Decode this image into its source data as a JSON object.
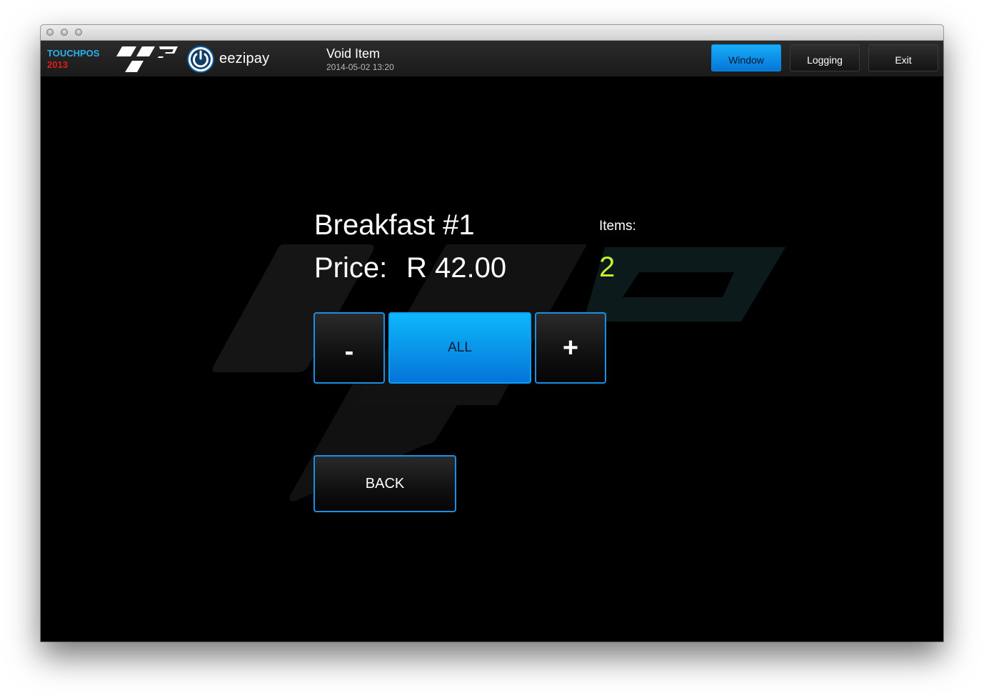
{
  "window": {
    "traffic_lights": [
      "close",
      "minimize",
      "zoom"
    ]
  },
  "header": {
    "brand_line1": "TOUCHPOS",
    "brand_line2": "2013",
    "brand_name": "eezipay",
    "screen_title": "Void Item",
    "screen_timestamp": "2014-05-02 13:20",
    "buttons": [
      {
        "label": "Window",
        "active": true
      },
      {
        "label": "Logging",
        "active": false
      },
      {
        "label": "Exit",
        "active": false
      }
    ]
  },
  "item": {
    "name": "Breakfast #1",
    "price_label": "Price:",
    "price_value": "R 42.00",
    "items_label": "Items:",
    "items_count": "2"
  },
  "controls": {
    "decrease_label": "-",
    "all_label": "ALL",
    "increase_label": "+",
    "back_label": "BACK"
  },
  "colors": {
    "accent": "#0a9ff0",
    "brand_blue": "#27b1ee",
    "brand_red": "#e01c1c",
    "count_green": "#c4f032"
  },
  "icons": {
    "logo": "tp-logo-icon",
    "power": "power-icon"
  }
}
